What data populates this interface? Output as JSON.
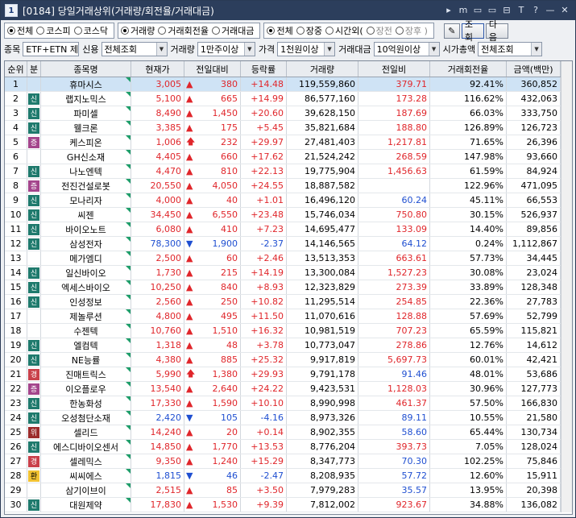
{
  "window": {
    "number": "1",
    "title": "[0184] 당일거래상위(거래량/회전율/거래대금)"
  },
  "title_buttons": [
    "▸",
    "m",
    "▭",
    "▭",
    "⊟",
    "T",
    "?",
    "—",
    "✕"
  ],
  "market_options": [
    {
      "label": "전체",
      "selected": true
    },
    {
      "label": "코스피",
      "selected": false
    },
    {
      "label": "코스닥",
      "selected": false
    }
  ],
  "sort_options": [
    {
      "label": "거래량",
      "selected": true
    },
    {
      "label": "거래회전율",
      "selected": false
    },
    {
      "label": "거래대금",
      "selected": false
    }
  ],
  "session_options": [
    {
      "label": "전체",
      "selected": true
    },
    {
      "label": "장중",
      "selected": false
    },
    {
      "label": "시간외(",
      "selected": false
    }
  ],
  "after_hours_options": [
    {
      "label": "장전",
      "selected": false
    },
    {
      "label": "장후 )",
      "selected": false
    }
  ],
  "buttons": {
    "settings": "✎",
    "search": "조회",
    "next": "다음"
  },
  "filters": {
    "item_label": "종목",
    "item_value": "ETF+ETN 제",
    "credit_label": "신용",
    "credit_value": "전체조회",
    "volume_label": "거래량",
    "volume_value": "1만주이상",
    "price_label": "가격",
    "price_value": "1천원이상",
    "amount_label": "거래대금",
    "amount_value": "10억원이상",
    "cap_label": "시가총액",
    "cap_value": "전체조회"
  },
  "colors": {
    "up": "#e0262b",
    "down": "#1f4fd1",
    "selected_row": "#cfe3f5"
  },
  "columns": [
    "순위",
    "분",
    "종목명",
    "현재가",
    "전일대비",
    "등락률",
    "거래량",
    "전일비",
    "거래회전율",
    "금액(백만)"
  ],
  "rows": [
    {
      "rank": "1",
      "badge": "",
      "name": "휴마시스",
      "price": "3,005",
      "dir": "up",
      "change": "380",
      "rate": "+14.48",
      "volume": "119,559,860",
      "prev": "379.71",
      "turnover": "92.41%",
      "amount": "360,852"
    },
    {
      "rank": "2",
      "badge": "신",
      "name": "랩지노믹스",
      "price": "5,100",
      "dir": "up",
      "change": "665",
      "rate": "+14.99",
      "volume": "86,577,160",
      "prev": "173.28",
      "turnover": "116.62%",
      "amount": "432,063"
    },
    {
      "rank": "3",
      "badge": "신",
      "name": "파미셀",
      "price": "8,490",
      "dir": "up",
      "change": "1,450",
      "rate": "+20.60",
      "volume": "39,628,150",
      "prev": "187.69",
      "turnover": "66.03%",
      "amount": "333,750"
    },
    {
      "rank": "4",
      "badge": "신",
      "name": "웰크론",
      "price": "3,385",
      "dir": "up",
      "change": "175",
      "rate": "+5.45",
      "volume": "35,821,684",
      "prev": "188.80",
      "turnover": "126.89%",
      "amount": "126,723"
    },
    {
      "rank": "5",
      "badge": "증",
      "name": "케스피온",
      "price": "1,006",
      "dir": "limit",
      "change": "232",
      "rate": "+29.97",
      "volume": "27,481,403",
      "prev": "1,217.81",
      "turnover": "71.65%",
      "amount": "26,396"
    },
    {
      "rank": "6",
      "badge": "",
      "name": "GH신소재",
      "price": "4,405",
      "dir": "up",
      "change": "660",
      "rate": "+17.62",
      "volume": "21,524,242",
      "prev": "268.59",
      "turnover": "147.98%",
      "amount": "93,660"
    },
    {
      "rank": "7",
      "badge": "신",
      "name": "나노엔텍",
      "price": "4,470",
      "dir": "up",
      "change": "810",
      "rate": "+22.13",
      "volume": "19,775,904",
      "prev": "1,456.63",
      "turnover": "61.59%",
      "amount": "84,924"
    },
    {
      "rank": "8",
      "badge": "증",
      "name": "전진건설로봇",
      "price": "20,550",
      "dir": "up",
      "change": "4,050",
      "rate": "+24.55",
      "volume": "18,887,582",
      "prev": "",
      "turnover": "122.96%",
      "amount": "471,095"
    },
    {
      "rank": "9",
      "badge": "신",
      "name": "모나리자",
      "price": "4,000",
      "dir": "up",
      "change": "40",
      "rate": "+1.01",
      "volume": "16,496,120",
      "prev": "60.24",
      "turnover": "45.11%",
      "amount": "66,553"
    },
    {
      "rank": "10",
      "badge": "신",
      "name": "씨젠",
      "price": "34,450",
      "dir": "up",
      "change": "6,550",
      "rate": "+23.48",
      "volume": "15,746,034",
      "prev": "750.80",
      "turnover": "30.15%",
      "amount": "526,937"
    },
    {
      "rank": "11",
      "badge": "신",
      "name": "바이오노트",
      "price": "6,080",
      "dir": "up",
      "change": "410",
      "rate": "+7.23",
      "volume": "14,695,477",
      "prev": "133.09",
      "turnover": "14.40%",
      "amount": "89,856"
    },
    {
      "rank": "12",
      "badge": "신",
      "name": "삼성전자",
      "price": "78,300",
      "dir": "down",
      "change": "1,900",
      "rate": "-2.37",
      "volume": "14,146,565",
      "prev": "64.12",
      "turnover": "0.24%",
      "amount": "1,112,867"
    },
    {
      "rank": "13",
      "badge": "",
      "name": "메가엠디",
      "price": "2,500",
      "dir": "up",
      "change": "60",
      "rate": "+2.46",
      "volume": "13,513,353",
      "prev": "663.61",
      "turnover": "57.73%",
      "amount": "34,445"
    },
    {
      "rank": "14",
      "badge": "신",
      "name": "일신바이오",
      "price": "1,730",
      "dir": "up",
      "change": "215",
      "rate": "+14.19",
      "volume": "13,300,084",
      "prev": "1,527.23",
      "turnover": "30.08%",
      "amount": "23,024"
    },
    {
      "rank": "15",
      "badge": "신",
      "name": "엑세스바이오",
      "price": "10,250",
      "dir": "up",
      "change": "840",
      "rate": "+8.93",
      "volume": "12,323,829",
      "prev": "273.39",
      "turnover": "33.89%",
      "amount": "128,348"
    },
    {
      "rank": "16",
      "badge": "신",
      "name": "인성정보",
      "price": "2,560",
      "dir": "up",
      "change": "250",
      "rate": "+10.82",
      "volume": "11,295,514",
      "prev": "254.85",
      "turnover": "22.36%",
      "amount": "27,783"
    },
    {
      "rank": "17",
      "badge": "",
      "name": "제놀루션",
      "price": "4,800",
      "dir": "up",
      "change": "495",
      "rate": "+11.50",
      "volume": "11,070,616",
      "prev": "128.88",
      "turnover": "57.69%",
      "amount": "52,799"
    },
    {
      "rank": "18",
      "badge": "",
      "name": "수젠텍",
      "price": "10,760",
      "dir": "up",
      "change": "1,510",
      "rate": "+16.32",
      "volume": "10,981,519",
      "prev": "707.23",
      "turnover": "65.59%",
      "amount": "115,821"
    },
    {
      "rank": "19",
      "badge": "신",
      "name": "엘컴텍",
      "price": "1,318",
      "dir": "up",
      "change": "48",
      "rate": "+3.78",
      "volume": "10,773,047",
      "prev": "278.86",
      "turnover": "12.76%",
      "amount": "14,612"
    },
    {
      "rank": "20",
      "badge": "신",
      "name": "NE능률",
      "price": "4,380",
      "dir": "up",
      "change": "885",
      "rate": "+25.32",
      "volume": "9,917,819",
      "prev": "5,697.73",
      "turnover": "60.01%",
      "amount": "42,421"
    },
    {
      "rank": "21",
      "badge": "경",
      "name": "진매트릭스",
      "price": "5,990",
      "dir": "limit",
      "change": "1,380",
      "rate": "+29.93",
      "volume": "9,791,178",
      "prev": "91.46",
      "turnover": "48.01%",
      "amount": "53,686"
    },
    {
      "rank": "22",
      "badge": "증",
      "name": "이오플로우",
      "price": "13,540",
      "dir": "up",
      "change": "2,640",
      "rate": "+24.22",
      "volume": "9,423,531",
      "prev": "1,128.03",
      "turnover": "30.96%",
      "amount": "127,773"
    },
    {
      "rank": "23",
      "badge": "신",
      "name": "한농화성",
      "price": "17,330",
      "dir": "up",
      "change": "1,590",
      "rate": "+10.10",
      "volume": "8,990,998",
      "prev": "461.37",
      "turnover": "57.50%",
      "amount": "166,830"
    },
    {
      "rank": "24",
      "badge": "신",
      "name": "오성첨단소재",
      "price": "2,420",
      "dir": "down",
      "change": "105",
      "rate": "-4.16",
      "volume": "8,973,326",
      "prev": "89.11",
      "turnover": "10.55%",
      "amount": "21,580"
    },
    {
      "rank": "25",
      "badge": "위",
      "name": "셀리드",
      "price": "14,240",
      "dir": "up",
      "change": "20",
      "rate": "+0.14",
      "volume": "8,902,355",
      "prev": "58.60",
      "turnover": "65.44%",
      "amount": "130,734"
    },
    {
      "rank": "26",
      "badge": "신",
      "name": "에스디바이오센서",
      "price": "14,850",
      "dir": "up",
      "change": "1,770",
      "rate": "+13.53",
      "volume": "8,776,204",
      "prev": "393.73",
      "turnover": "7.05%",
      "amount": "128,024"
    },
    {
      "rank": "27",
      "badge": "경",
      "name": "셀레믹스",
      "price": "9,350",
      "dir": "up",
      "change": "1,240",
      "rate": "+15.29",
      "volume": "8,347,773",
      "prev": "70.30",
      "turnover": "102.25%",
      "amount": "75,846"
    },
    {
      "rank": "28",
      "badge": "환",
      "name": "씨씨에스",
      "price": "1,815",
      "dir": "down",
      "change": "46",
      "rate": "-2.47",
      "volume": "8,208,935",
      "prev": "57.72",
      "turnover": "12.60%",
      "amount": "15,911"
    },
    {
      "rank": "29",
      "badge": "",
      "name": "삼기이브이",
      "price": "2,515",
      "dir": "up",
      "change": "85",
      "rate": "+3.50",
      "volume": "7,979,283",
      "prev": "35.57",
      "turnover": "13.95%",
      "amount": "20,398"
    },
    {
      "rank": "30",
      "badge": "신",
      "name": "대원제약",
      "price": "17,830",
      "dir": "up",
      "change": "1,530",
      "rate": "+9.39",
      "volume": "7,812,002",
      "prev": "923.67",
      "turnover": "34.88%",
      "amount": "136,082"
    }
  ]
}
